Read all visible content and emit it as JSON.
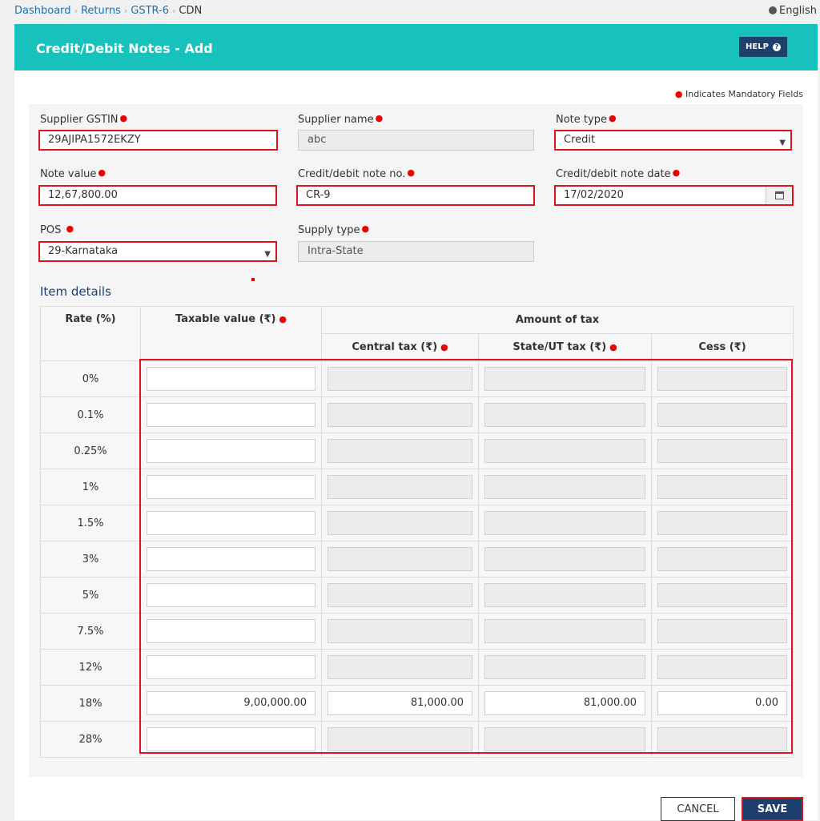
{
  "breadcrumb": [
    {
      "label": "Dashboard"
    },
    {
      "label": "Returns"
    },
    {
      "label": "GSTR-6"
    },
    {
      "label": "CDN"
    }
  ],
  "language": "English",
  "header": {
    "title": "Credit/Debit Notes - Add",
    "help_label": "HELP"
  },
  "mandatory_note": "Indicates Mandatory Fields",
  "form": {
    "supplier_gstin": {
      "label": "Supplier GSTIN",
      "value": "29AJIPA1572EKZY"
    },
    "supplier_name": {
      "label": "Supplier name",
      "value": "abc"
    },
    "note_type": {
      "label": "Note type",
      "value": "Credit"
    },
    "note_value": {
      "label": "Note value",
      "value": "12,67,800.00"
    },
    "note_no": {
      "label": "Credit/debit note no.",
      "value": "CR-9"
    },
    "note_date": {
      "label": "Credit/debit note date",
      "value": "17/02/2020"
    },
    "pos": {
      "label": "POS",
      "value": "29-Karnataka"
    },
    "supply_type": {
      "label": "Supply type",
      "value": "Intra-State"
    }
  },
  "items": {
    "title": "Item details",
    "headers": {
      "rate": "Rate (%)",
      "taxable": "Taxable value (₹)",
      "amount_of_tax": "Amount of tax",
      "central": "Central tax (₹)",
      "state": "State/UT tax (₹)",
      "cess": "Cess (₹)"
    },
    "rows": [
      {
        "rate": "0%",
        "taxable": "",
        "central": "",
        "state": "",
        "cess": ""
      },
      {
        "rate": "0.1%",
        "taxable": "",
        "central": "",
        "state": "",
        "cess": ""
      },
      {
        "rate": "0.25%",
        "taxable": "",
        "central": "",
        "state": "",
        "cess": ""
      },
      {
        "rate": "1%",
        "taxable": "",
        "central": "",
        "state": "",
        "cess": ""
      },
      {
        "rate": "1.5%",
        "taxable": "",
        "central": "",
        "state": "",
        "cess": ""
      },
      {
        "rate": "3%",
        "taxable": "",
        "central": "",
        "state": "",
        "cess": ""
      },
      {
        "rate": "5%",
        "taxable": "",
        "central": "",
        "state": "",
        "cess": ""
      },
      {
        "rate": "7.5%",
        "taxable": "",
        "central": "",
        "state": "",
        "cess": ""
      },
      {
        "rate": "12%",
        "taxable": "",
        "central": "",
        "state": "",
        "cess": ""
      },
      {
        "rate": "18%",
        "taxable": "9,00,000.00",
        "central": "81,000.00",
        "state": "81,000.00",
        "cess": "0.00"
      },
      {
        "rate": "28%",
        "taxable": "",
        "central": "",
        "state": "",
        "cess": ""
      }
    ]
  },
  "actions": {
    "cancel_label": "CANCEL",
    "save_label": "SAVE"
  }
}
